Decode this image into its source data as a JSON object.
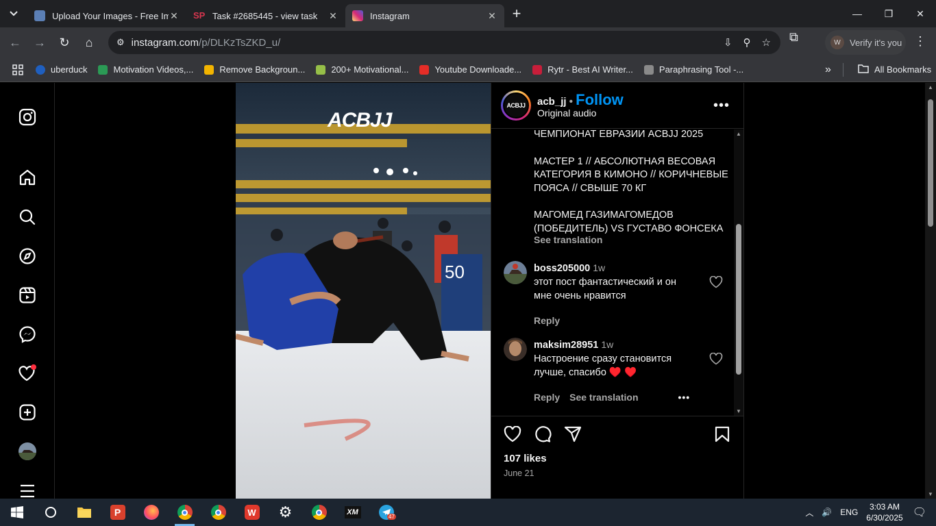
{
  "browser": {
    "tabs": [
      {
        "title": "Upload Your Images - Free Imag",
        "active": false
      },
      {
        "title": "Task #2685445 - view task",
        "active": false
      },
      {
        "title": "Instagram",
        "active": true
      }
    ],
    "new_tab": "+",
    "url_domain": "instagram.com",
    "url_path": "/p/DLKzTsZKD_u/",
    "verify_label": "Verify it's you",
    "verify_avatar": "W",
    "bookmarks": [
      {
        "label": "uberduck",
        "color": "#1f5fbf"
      },
      {
        "label": "Motivation Videos,...",
        "color": "#2b9a55"
      },
      {
        "label": "Remove Backgroun...",
        "color": "#f2b400"
      },
      {
        "label": "200+ Motivational...",
        "color": "#96bf48"
      },
      {
        "label": "Youtube Downloade...",
        "color": "#e52d27"
      },
      {
        "label": "Rytr - Best AI Writer...",
        "color": "#c81e3a"
      },
      {
        "label": "Paraphrasing Tool -...",
        "color": "#8a8a8a"
      }
    ],
    "all_bookmarks": "All Bookmarks"
  },
  "post": {
    "username": "acb_jj",
    "avatar_text": "ACBJJ",
    "follow_label": "Follow",
    "audio": "Original audio",
    "brand_overlay": "ACBJJ",
    "caption_lines": [
      "ЧЕМПИОНАТ ЕВРАЗИИ ACBJJ 2025",
      "",
      "МАСТЕР 1 // АБСОЛЮТНАЯ ВЕСОВАЯ КАТЕГОРИЯ В КИМОНО // КОРИЧНЕВЫЕ ПОЯСА // СВЫШЕ 70 КГ",
      "",
      "МАГОМЕД ГАЗИМАГОМЕДОВ (ПОБЕДИТЕЛЬ) VS ГУСТАВО ФОНСЕКА"
    ],
    "see_translation": "See translation",
    "comments": [
      {
        "user": "boss205000",
        "time": "1w",
        "text": "этот пост фантастический и он мне очень нравится",
        "reply": "Reply"
      },
      {
        "user": "maksim28951",
        "time": "1w",
        "text": "Настроение сразу становится лучше, спасибо ♥️ ♥️",
        "reply": "Reply",
        "see_translation": "See translation"
      }
    ],
    "likes": "107 likes",
    "date": "June 21"
  },
  "taskbar": {
    "lang": "ENG",
    "time": "3:03 AM",
    "date": "6/30/2025",
    "telegram_badge": "47"
  },
  "colors": {
    "accent": "#0095f6",
    "notification": "#ff3040"
  }
}
